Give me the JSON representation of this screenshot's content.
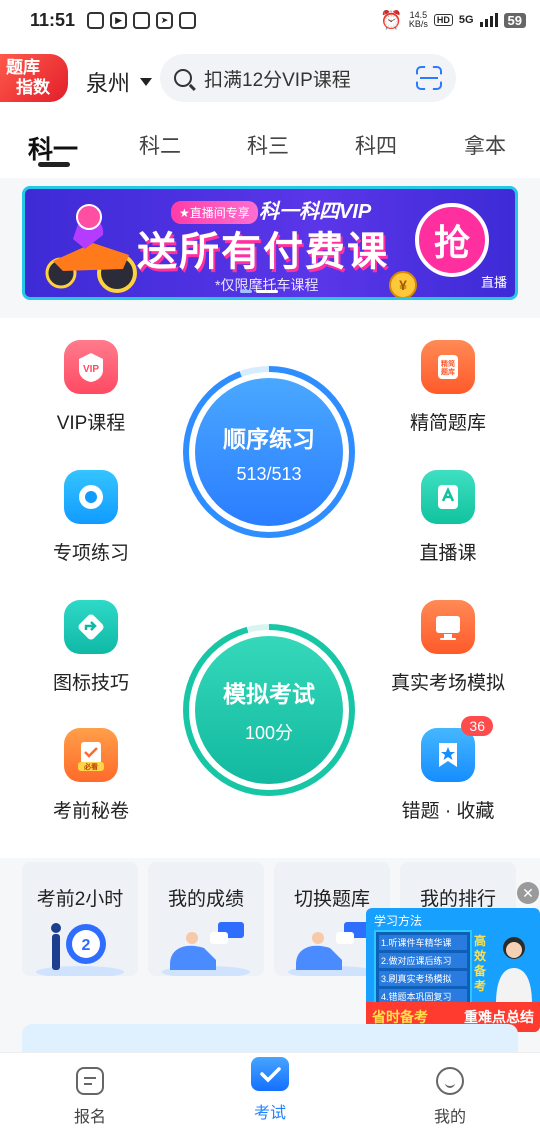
{
  "status_bar": {
    "time": "11:51",
    "net_speed_value": "14.5",
    "net_speed_unit": "KB/s",
    "hd": "HD",
    "network": "5G",
    "battery": "59"
  },
  "header": {
    "logo_text_1": "题库",
    "logo_text_2": "指数",
    "city": "泉州",
    "search_placeholder": "扣满12分VIP课程"
  },
  "tabs": [
    "科一",
    "科二",
    "科三",
    "科四",
    "拿本"
  ],
  "banner": {
    "tag": "★直播间专享",
    "title_top": "科一科四VIP",
    "title_main": "送所有付费课",
    "subtitle": "*仅限摩托车课程",
    "grab": "抢",
    "coin": "¥",
    "live": "直播"
  },
  "features_left": [
    {
      "label": "VIP课程",
      "icon": "vip-icon",
      "color": "#ff5b6e"
    },
    {
      "label": "专项练习",
      "icon": "target-icon",
      "color": "#1fb6ff"
    },
    {
      "label": "图标技巧",
      "icon": "road-sign-icon",
      "color": "#16c6b6"
    },
    {
      "label": "考前秘卷",
      "icon": "exam-paper-icon",
      "color": "#ff8a3c"
    }
  ],
  "features_right": [
    {
      "label": "精简题库",
      "icon": "question-bank-icon",
      "color": "#ff6a3a"
    },
    {
      "label": "直播课",
      "icon": "live-class-icon",
      "color": "#18c7a6"
    },
    {
      "label": "真实考场模拟",
      "icon": "monitor-icon",
      "color": "#ff6d3f"
    },
    {
      "label": "错题 · 收藏",
      "icon": "star-bookmark-icon",
      "color": "#2aa8ff",
      "badge": "36"
    }
  ],
  "practice": {
    "sequential_title": "顺序练习",
    "sequential_progress": "513/513",
    "mock_title": "模拟考试",
    "mock_score": "100分"
  },
  "cards": [
    "考前2小时",
    "我的成绩",
    "切换题库",
    "我的排行"
  ],
  "float_ad": {
    "header": "学习方法",
    "items": [
      "1.听课件车精华课",
      "2.做对应课后练习",
      "3.刷真实考场模拟",
      "4.错题本巩固复习"
    ],
    "side": "高效备考",
    "bar_left": "省时备考",
    "bar_right": "重难点总结"
  },
  "nav": [
    {
      "label": "报名",
      "icon": "register-icon"
    },
    {
      "label": "考试",
      "icon": "exam-icon",
      "active": true
    },
    {
      "label": "我的",
      "icon": "profile-icon"
    }
  ]
}
